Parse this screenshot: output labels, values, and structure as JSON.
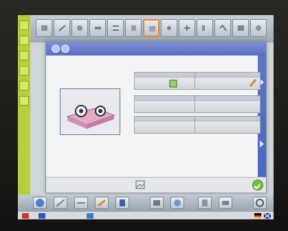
{
  "dialog": {
    "title": "",
    "params": [
      {
        "label": "",
        "value": ""
      },
      {
        "label": "",
        "value": ""
      },
      {
        "label": "",
        "value": ""
      },
      {
        "label": "",
        "value": ""
      },
      {
        "label": "",
        "value": ""
      },
      {
        "label": "",
        "value": ""
      }
    ],
    "preview_caption": ""
  },
  "status": {
    "text_left": "",
    "text_mid": ""
  },
  "colors": {
    "header_blue": "#5a6fc4",
    "sidebar_green": "#b8cf3c",
    "highlight_orange": "#e3862d",
    "ok_green": "#7bbd3d"
  },
  "icons": {
    "top_toolbar": [
      "tool-icon"
    ],
    "bottom_toolbar": [
      "tool-icon"
    ]
  }
}
